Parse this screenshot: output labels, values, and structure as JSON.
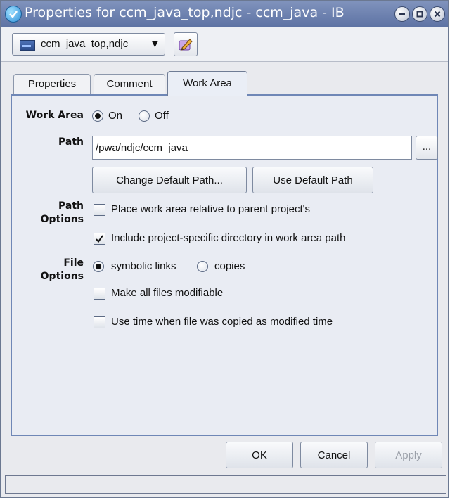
{
  "window": {
    "title": "Properties for ccm_java_top,ndjc - ccm_java - IB",
    "controls": [
      "minimize-icon",
      "maximize-icon",
      "close-icon"
    ]
  },
  "toolbar": {
    "project_selector": "ccm_java_top,ndjc",
    "project_icon": "project-icon",
    "edit_icon": "edit-pencil-icon"
  },
  "tabs": [
    {
      "label": "Properties",
      "active": false
    },
    {
      "label": "Comment",
      "active": false
    },
    {
      "label": "Work Area",
      "active": true
    }
  ],
  "work_area": {
    "label": "Work Area",
    "on_label": "On",
    "off_label": "Off",
    "selected": "On"
  },
  "path": {
    "label": "Path",
    "value": "/pwa/ndjc/ccm_java",
    "browse_label": "...",
    "change_default_label": "Change Default Path...",
    "use_default_label": "Use Default Path"
  },
  "path_options": {
    "label_line1": "Path",
    "label_line2": "Options",
    "relative_label": "Place work area relative to parent project's",
    "relative_checked": false,
    "include_dir_label": "Include project-specific directory in work area path",
    "include_dir_checked": true
  },
  "file_options": {
    "label_line1": "File",
    "label_line2": "Options",
    "symbolic_label": "symbolic links",
    "copies_label": "copies",
    "selected": "symbolic links",
    "modifiable_label": "Make all files modifiable",
    "modifiable_checked": false,
    "use_time_label": "Use time when file was copied as modified time",
    "use_time_checked": false
  },
  "buttons": {
    "ok": "OK",
    "cancel": "Cancel",
    "apply": "Apply",
    "apply_enabled": false
  },
  "colors": {
    "titlebar": "#6a7eae",
    "panel_border": "#6f87b6"
  }
}
